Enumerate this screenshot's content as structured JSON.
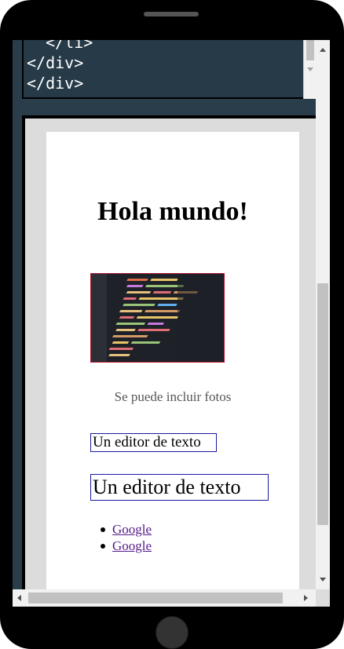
{
  "editor": {
    "code_lines": [
      "  </li>",
      "</div>",
      "</div>"
    ]
  },
  "preview": {
    "heading": "Hola mundo!",
    "image_alt": "code-screen-photo",
    "caption": "Se puede incluir fotos",
    "box_small_text": "Un editor de texto",
    "box_large_text": "Un editor de texto",
    "links": [
      "Google",
      "Google"
    ]
  },
  "colors": {
    "editor_bg": "#263a48",
    "link": "#551a8b",
    "box_border": "#1a1aa0",
    "image_border": "#b2152e"
  }
}
